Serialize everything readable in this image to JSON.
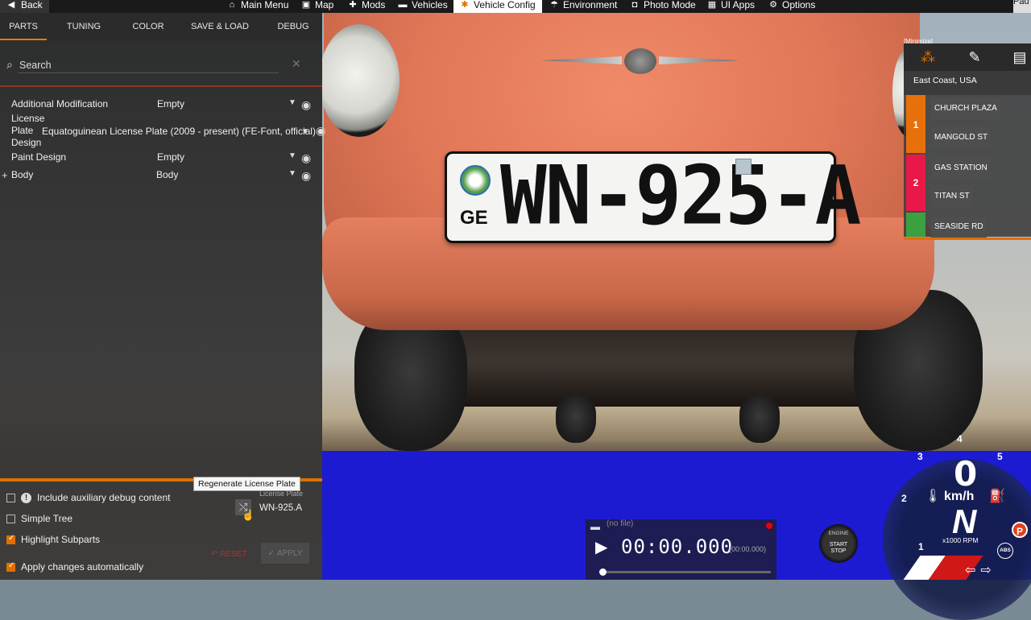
{
  "topbar": {
    "back": "Back",
    "items": [
      {
        "label": "Main Menu",
        "icon": "home-icon"
      },
      {
        "label": "Map",
        "icon": "map-icon"
      },
      {
        "label": "Mods",
        "icon": "mods-icon"
      },
      {
        "label": "Vehicles",
        "icon": "car-icon"
      },
      {
        "label": "Vehicle Config",
        "icon": "gear-icon",
        "active": true
      },
      {
        "label": "Environment",
        "icon": "environment-icon"
      },
      {
        "label": "Photo Mode",
        "icon": "camera-icon"
      },
      {
        "label": "UI Apps",
        "icon": "apps-icon"
      },
      {
        "label": "Options",
        "icon": "settings-icon"
      }
    ],
    "pause": "Pau"
  },
  "panel": {
    "tabs": [
      "PARTS",
      "TUNING",
      "COLOR",
      "SAVE & LOAD",
      "DEBUG"
    ],
    "search": {
      "placeholder": "Search",
      "value": ""
    },
    "parts": [
      {
        "label": "Additional Modification",
        "value": "Empty"
      },
      {
        "label_lines": [
          "License",
          "Plate",
          "Design"
        ],
        "value": "Equatoguinean License Plate (2009 - present) (FE-Font, official)"
      },
      {
        "label": "Paint Design",
        "value": "Empty"
      },
      {
        "label": "Body",
        "value": "Body"
      }
    ],
    "options": [
      {
        "label": "Include auxiliary debug content",
        "checked": false
      },
      {
        "label": "Simple Tree",
        "checked": false
      },
      {
        "label": "Highlight Subparts",
        "checked": true
      },
      {
        "label": "Apply changes automatically",
        "checked": true
      }
    ],
    "tooltip": "Regenerate License Plate",
    "plate_label": "License Plate",
    "plate_value": "WN-925.A",
    "reset": "RESET",
    "apply": "APPLY"
  },
  "scene": {
    "plate_number": "WN-925-A",
    "plate_country": "GE"
  },
  "nav": {
    "minimize": "[Minimize]",
    "location": "East Coast, USA",
    "segments": [
      {
        "num": "1",
        "color": "#e8700a"
      },
      {
        "num": "2",
        "color": "#e81848"
      },
      {
        "num": "",
        "color": "#3aa040"
      }
    ],
    "streets": [
      "CHURCH PLAZA",
      "MANGOLD ST",
      "GAS STATION",
      "TITAN ST",
      "SEASIDE RD"
    ]
  },
  "replay": {
    "file": "(no file)",
    "time": "00:00.000",
    "sub_time": "(00:00.000)"
  },
  "engine": {
    "line1": "ENGINE",
    "line2": "START",
    "line3": "STOP"
  },
  "gauge": {
    "speed": "0",
    "unit": "km/h",
    "gear": "N",
    "rpm_label": "x1000 RPM",
    "ticks": [
      "1",
      "2",
      "3",
      "4",
      "5"
    ],
    "park": "P",
    "abs": "ABS"
  }
}
